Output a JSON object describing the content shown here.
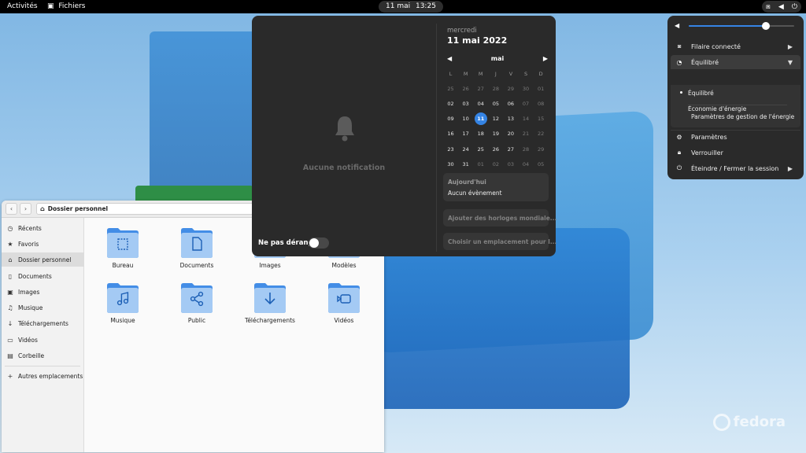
{
  "topbar": {
    "activities": "Activités",
    "app_name": "Fichiers",
    "clock_date": "11 mai",
    "clock_time": "13:25"
  },
  "calendar": {
    "notifications_empty": "Aucune notification",
    "do_not_disturb_label": "Ne pas déranger",
    "do_not_disturb_on": false,
    "weekday": "mercredi",
    "full_date": "11 mai 2022",
    "month": "mai",
    "day_headers": [
      "L",
      "M",
      "M",
      "J",
      "V",
      "S",
      "D"
    ],
    "days": [
      {
        "d": "25",
        "o": true
      },
      {
        "d": "26",
        "o": true
      },
      {
        "d": "27",
        "o": true
      },
      {
        "d": "28",
        "o": true
      },
      {
        "d": "29",
        "o": true
      },
      {
        "d": "30",
        "o": true
      },
      {
        "d": "01",
        "o": true
      },
      {
        "d": "02"
      },
      {
        "d": "03"
      },
      {
        "d": "04"
      },
      {
        "d": "05"
      },
      {
        "d": "06"
      },
      {
        "d": "07",
        "o": true
      },
      {
        "d": "08",
        "o": true
      },
      {
        "d": "09"
      },
      {
        "d": "10"
      },
      {
        "d": "11",
        "t": true
      },
      {
        "d": "12"
      },
      {
        "d": "13"
      },
      {
        "d": "14",
        "o": true
      },
      {
        "d": "15",
        "o": true
      },
      {
        "d": "16"
      },
      {
        "d": "17"
      },
      {
        "d": "18"
      },
      {
        "d": "19"
      },
      {
        "d": "20"
      },
      {
        "d": "21",
        "o": true
      },
      {
        "d": "22",
        "o": true
      },
      {
        "d": "23"
      },
      {
        "d": "24"
      },
      {
        "d": "25"
      },
      {
        "d": "26"
      },
      {
        "d": "27"
      },
      {
        "d": "28",
        "o": true
      },
      {
        "d": "29",
        "o": true
      },
      {
        "d": "30"
      },
      {
        "d": "31"
      },
      {
        "d": "01",
        "o": true
      },
      {
        "d": "02",
        "o": true
      },
      {
        "d": "03",
        "o": true
      },
      {
        "d": "04",
        "o": true
      },
      {
        "d": "05",
        "o": true
      }
    ],
    "today_title": "Aujourd'hui",
    "today_events": "Aucun évènement",
    "world_clocks": "Ajouter des horloges mondiale...",
    "weather": "Choisir un emplacement pour l..."
  },
  "quick_settings": {
    "volume_level": 0.73,
    "wired": "Filaire connecté",
    "power_mode": "Équilibré",
    "power_options": [
      "Équilibré",
      "Économie d'énergie"
    ],
    "power_settings": "Paramètres de gestion de l'énergie",
    "settings": "Paramètres",
    "lock": "Verrouiller",
    "power_off": "Éteindre / Fermer la session"
  },
  "files": {
    "path": "Dossier personnel",
    "sidebar": [
      {
        "label": "Récents",
        "icon": "clock-icon"
      },
      {
        "label": "Favoris",
        "icon": "star-icon"
      },
      {
        "label": "Dossier personnel",
        "icon": "home-icon",
        "active": true
      },
      {
        "label": "Documents",
        "icon": "document-icon"
      },
      {
        "label": "Images",
        "icon": "image-icon"
      },
      {
        "label": "Musique",
        "icon": "music-icon"
      },
      {
        "label": "Téléchargements",
        "icon": "download-icon"
      },
      {
        "label": "Vidéos",
        "icon": "video-icon"
      },
      {
        "label": "Corbeille",
        "icon": "trash-icon"
      }
    ],
    "other_locations": "Autres emplacements",
    "folders": [
      {
        "label": "Bureau",
        "icon": "desktop-icon"
      },
      {
        "label": "Documents",
        "icon": "document-icon"
      },
      {
        "label": "Images",
        "icon": "image-icon"
      },
      {
        "label": "Modèles",
        "icon": "template-icon"
      },
      {
        "label": "Musique",
        "icon": "music-icon"
      },
      {
        "label": "Public",
        "icon": "share-icon"
      },
      {
        "label": "Téléchargements",
        "icon": "download-icon"
      },
      {
        "label": "Vidéos",
        "icon": "video-icon"
      }
    ]
  },
  "brand": "fedora"
}
